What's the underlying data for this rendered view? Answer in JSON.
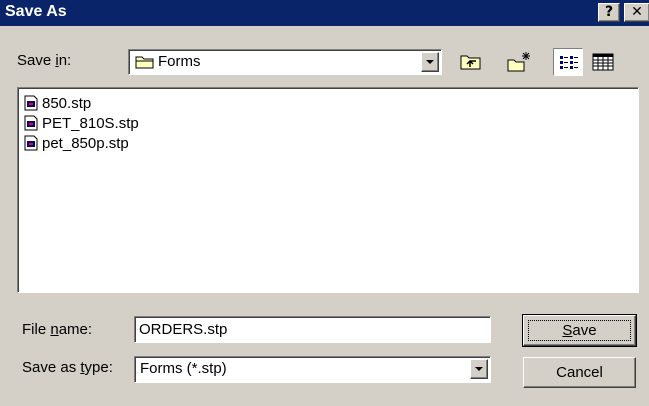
{
  "window": {
    "title": "Save As",
    "help_glyph": "?",
    "close_glyph": "✕"
  },
  "save_in": {
    "label_pre": "Save ",
    "label_key": "i",
    "label_post": "n:",
    "value": "Forms",
    "icon": "folder-icon"
  },
  "toolbar": {
    "buttons": [
      {
        "name": "up-one-level-button",
        "icon": "folder-up-icon"
      },
      {
        "name": "create-new-folder-button",
        "icon": "new-folder-icon"
      },
      {
        "name": "list-view-button",
        "icon": "list-view-icon",
        "pressed": true
      },
      {
        "name": "details-view-button",
        "icon": "details-view-icon"
      }
    ]
  },
  "files": [
    {
      "name": "850.stp",
      "icon": "stp-file-icon"
    },
    {
      "name": "PET_810S.stp",
      "icon": "stp-file-icon"
    },
    {
      "name": "pet_850p.stp",
      "icon": "stp-file-icon"
    }
  ],
  "file_name": {
    "label_pre": "File ",
    "label_key": "n",
    "label_post": "ame:",
    "value": "ORDERS.stp"
  },
  "save_as_type": {
    "label_pre": "Save as ",
    "label_key": "t",
    "label_post": "ype:",
    "value": "Forms (*.stp)"
  },
  "buttons": {
    "save_key": "S",
    "save_rest": "ave",
    "cancel": "Cancel"
  },
  "colors": {
    "titlebar": "#0a246a",
    "face": "#d4d0c8",
    "window": "#ffffff"
  }
}
